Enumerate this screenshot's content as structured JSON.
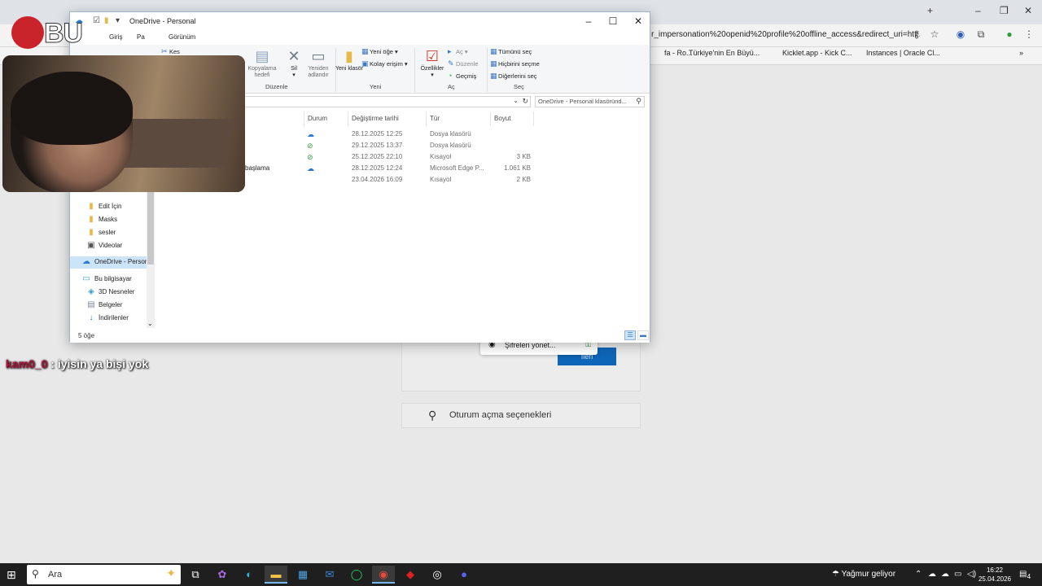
{
  "browser": {
    "url": "r_impersonation%20openid%20profile%20offline_access&redirect_uri=htt...",
    "bookmarks": [
      "fa - Ro...",
      "Türkiye'nin En Büyü...",
      "Kicklet.app - Kick C...",
      "Instances | Oracle Cl..."
    ]
  },
  "login": {
    "next_label": "İleri",
    "signin_options": "Oturum açma seçenekleri",
    "password_popup": "Şifreleri yönet..."
  },
  "explorer": {
    "title": "OneDrive - Personal",
    "tabs": [
      "Giriş",
      "Pa",
      "Görünüm"
    ],
    "ribbon": {
      "cut": "Kes",
      "copy_path": "Kopyalama hedefi",
      "delete": "Sil",
      "rename": "Yeniden adlandır",
      "group_organize": "Düzenle",
      "new_folder": "Yeni klasör",
      "new_item": "Yeni öğe",
      "easy_access": "Kolay erişim",
      "group_new": "Yeni",
      "properties": "Özellikler",
      "open": "Aç",
      "edit": "Düzenle",
      "history": "Geçmiş",
      "group_open": "Aç",
      "select_all": "Tümünü seç",
      "select_none": "Hiçbirini seçme",
      "invert_selection": "Diğerlerini seç",
      "group_select": "Seç"
    },
    "search_placeholder": "OneDrive - Personal klasöründ...",
    "nav_items": [
      {
        "label": "Edit İçin",
        "icon": "folder-icon"
      },
      {
        "label": "Masks",
        "icon": "folder-icon"
      },
      {
        "label": "sesler",
        "icon": "folder-icon"
      },
      {
        "label": "Videolar",
        "icon": "videos-icon"
      },
      {
        "label": "OneDrive - Personal",
        "icon": "onedrive-icon"
      },
      {
        "label": "Bu bilgisayar",
        "icon": "computer-icon"
      },
      {
        "label": "3D Nesneler",
        "icon": "3d-icon"
      },
      {
        "label": "Belgeler",
        "icon": "documents-icon"
      },
      {
        "label": "İndirilenler",
        "icon": "downloads-icon"
      }
    ],
    "columns": [
      "Durum",
      "Değiştirme tarihi",
      "Tür",
      "Boyut"
    ],
    "rows": [
      {
        "name": "",
        "status": "cloud",
        "date": "28.12.2025 12:25",
        "type": "Dosya klasörü",
        "size": ""
      },
      {
        "name": "",
        "status": "synced",
        "date": "29.12.2025 13:37",
        "type": "Dosya klasörü",
        "size": ""
      },
      {
        "name": "",
        "status": "synced",
        "date": "25.12.2025 22:10",
        "type": "Kısayol",
        "size": "3 KB"
      },
      {
        "name": "başlama",
        "status": "cloud",
        "date": "28.12.2025 12:24",
        "type": "Microsoft Edge P...",
        "size": "1.061 KB"
      },
      {
        "name": "",
        "status": "",
        "date": "23.04.2026 16:09",
        "type": "Kısayol",
        "size": "2 KB"
      }
    ],
    "item_count": "5 öğe"
  },
  "chat": {
    "user": "kam0_0",
    "sep": " : ",
    "message": "iyisin ya bişi yok"
  },
  "taskbar": {
    "search_label": "Ara",
    "weather": "Yağmur geliyor",
    "time": "16:22",
    "date": "25.04.2026",
    "notif_count": "4"
  },
  "colors": {
    "accent": "#0e66b8",
    "chat_user": "#b0123a",
    "selection": "#cce4f7"
  }
}
